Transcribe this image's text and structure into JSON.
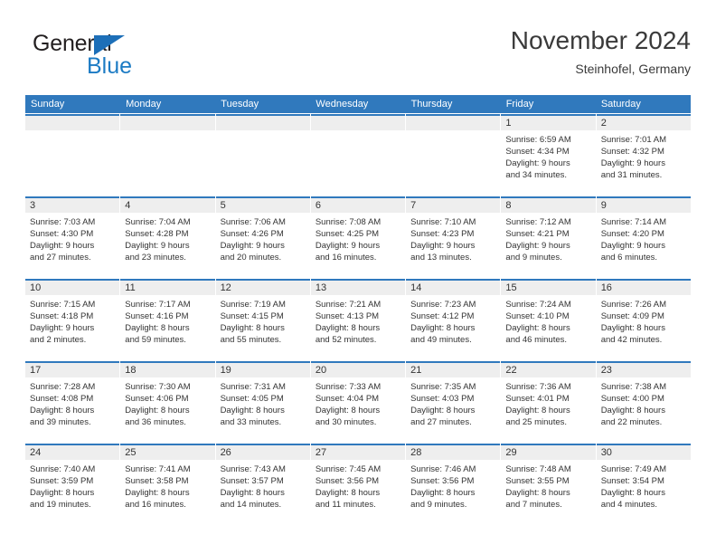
{
  "brand": {
    "word1": "General",
    "word2": "Blue",
    "triangle_color": "#1d6fb8",
    "blue_color": "#1c7bc4"
  },
  "header": {
    "title": "November 2024",
    "location": "Steinhofel, Germany"
  },
  "theme": {
    "header_bar": "#3079bd",
    "date_band": "#eeeeee",
    "text": "#333333"
  },
  "weekdays": [
    "Sunday",
    "Monday",
    "Tuesday",
    "Wednesday",
    "Thursday",
    "Friday",
    "Saturday"
  ],
  "weeks": [
    [
      {
        "date": "",
        "lines": []
      },
      {
        "date": "",
        "lines": []
      },
      {
        "date": "",
        "lines": []
      },
      {
        "date": "",
        "lines": []
      },
      {
        "date": "",
        "lines": []
      },
      {
        "date": "1",
        "lines": [
          "Sunrise: 6:59 AM",
          "Sunset: 4:34 PM",
          "Daylight: 9 hours",
          "and 34 minutes."
        ]
      },
      {
        "date": "2",
        "lines": [
          "Sunrise: 7:01 AM",
          "Sunset: 4:32 PM",
          "Daylight: 9 hours",
          "and 31 minutes."
        ]
      }
    ],
    [
      {
        "date": "3",
        "lines": [
          "Sunrise: 7:03 AM",
          "Sunset: 4:30 PM",
          "Daylight: 9 hours",
          "and 27 minutes."
        ]
      },
      {
        "date": "4",
        "lines": [
          "Sunrise: 7:04 AM",
          "Sunset: 4:28 PM",
          "Daylight: 9 hours",
          "and 23 minutes."
        ]
      },
      {
        "date": "5",
        "lines": [
          "Sunrise: 7:06 AM",
          "Sunset: 4:26 PM",
          "Daylight: 9 hours",
          "and 20 minutes."
        ]
      },
      {
        "date": "6",
        "lines": [
          "Sunrise: 7:08 AM",
          "Sunset: 4:25 PM",
          "Daylight: 9 hours",
          "and 16 minutes."
        ]
      },
      {
        "date": "7",
        "lines": [
          "Sunrise: 7:10 AM",
          "Sunset: 4:23 PM",
          "Daylight: 9 hours",
          "and 13 minutes."
        ]
      },
      {
        "date": "8",
        "lines": [
          "Sunrise: 7:12 AM",
          "Sunset: 4:21 PM",
          "Daylight: 9 hours",
          "and 9 minutes."
        ]
      },
      {
        "date": "9",
        "lines": [
          "Sunrise: 7:14 AM",
          "Sunset: 4:20 PM",
          "Daylight: 9 hours",
          "and 6 minutes."
        ]
      }
    ],
    [
      {
        "date": "10",
        "lines": [
          "Sunrise: 7:15 AM",
          "Sunset: 4:18 PM",
          "Daylight: 9 hours",
          "and 2 minutes."
        ]
      },
      {
        "date": "11",
        "lines": [
          "Sunrise: 7:17 AM",
          "Sunset: 4:16 PM",
          "Daylight: 8 hours",
          "and 59 minutes."
        ]
      },
      {
        "date": "12",
        "lines": [
          "Sunrise: 7:19 AM",
          "Sunset: 4:15 PM",
          "Daylight: 8 hours",
          "and 55 minutes."
        ]
      },
      {
        "date": "13",
        "lines": [
          "Sunrise: 7:21 AM",
          "Sunset: 4:13 PM",
          "Daylight: 8 hours",
          "and 52 minutes."
        ]
      },
      {
        "date": "14",
        "lines": [
          "Sunrise: 7:23 AM",
          "Sunset: 4:12 PM",
          "Daylight: 8 hours",
          "and 49 minutes."
        ]
      },
      {
        "date": "15",
        "lines": [
          "Sunrise: 7:24 AM",
          "Sunset: 4:10 PM",
          "Daylight: 8 hours",
          "and 46 minutes."
        ]
      },
      {
        "date": "16",
        "lines": [
          "Sunrise: 7:26 AM",
          "Sunset: 4:09 PM",
          "Daylight: 8 hours",
          "and 42 minutes."
        ]
      }
    ],
    [
      {
        "date": "17",
        "lines": [
          "Sunrise: 7:28 AM",
          "Sunset: 4:08 PM",
          "Daylight: 8 hours",
          "and 39 minutes."
        ]
      },
      {
        "date": "18",
        "lines": [
          "Sunrise: 7:30 AM",
          "Sunset: 4:06 PM",
          "Daylight: 8 hours",
          "and 36 minutes."
        ]
      },
      {
        "date": "19",
        "lines": [
          "Sunrise: 7:31 AM",
          "Sunset: 4:05 PM",
          "Daylight: 8 hours",
          "and 33 minutes."
        ]
      },
      {
        "date": "20",
        "lines": [
          "Sunrise: 7:33 AM",
          "Sunset: 4:04 PM",
          "Daylight: 8 hours",
          "and 30 minutes."
        ]
      },
      {
        "date": "21",
        "lines": [
          "Sunrise: 7:35 AM",
          "Sunset: 4:03 PM",
          "Daylight: 8 hours",
          "and 27 minutes."
        ]
      },
      {
        "date": "22",
        "lines": [
          "Sunrise: 7:36 AM",
          "Sunset: 4:01 PM",
          "Daylight: 8 hours",
          "and 25 minutes."
        ]
      },
      {
        "date": "23",
        "lines": [
          "Sunrise: 7:38 AM",
          "Sunset: 4:00 PM",
          "Daylight: 8 hours",
          "and 22 minutes."
        ]
      }
    ],
    [
      {
        "date": "24",
        "lines": [
          "Sunrise: 7:40 AM",
          "Sunset: 3:59 PM",
          "Daylight: 8 hours",
          "and 19 minutes."
        ]
      },
      {
        "date": "25",
        "lines": [
          "Sunrise: 7:41 AM",
          "Sunset: 3:58 PM",
          "Daylight: 8 hours",
          "and 16 minutes."
        ]
      },
      {
        "date": "26",
        "lines": [
          "Sunrise: 7:43 AM",
          "Sunset: 3:57 PM",
          "Daylight: 8 hours",
          "and 14 minutes."
        ]
      },
      {
        "date": "27",
        "lines": [
          "Sunrise: 7:45 AM",
          "Sunset: 3:56 PM",
          "Daylight: 8 hours",
          "and 11 minutes."
        ]
      },
      {
        "date": "28",
        "lines": [
          "Sunrise: 7:46 AM",
          "Sunset: 3:56 PM",
          "Daylight: 8 hours",
          "and 9 minutes."
        ]
      },
      {
        "date": "29",
        "lines": [
          "Sunrise: 7:48 AM",
          "Sunset: 3:55 PM",
          "Daylight: 8 hours",
          "and 7 minutes."
        ]
      },
      {
        "date": "30",
        "lines": [
          "Sunrise: 7:49 AM",
          "Sunset: 3:54 PM",
          "Daylight: 8 hours",
          "and 4 minutes."
        ]
      }
    ]
  ]
}
